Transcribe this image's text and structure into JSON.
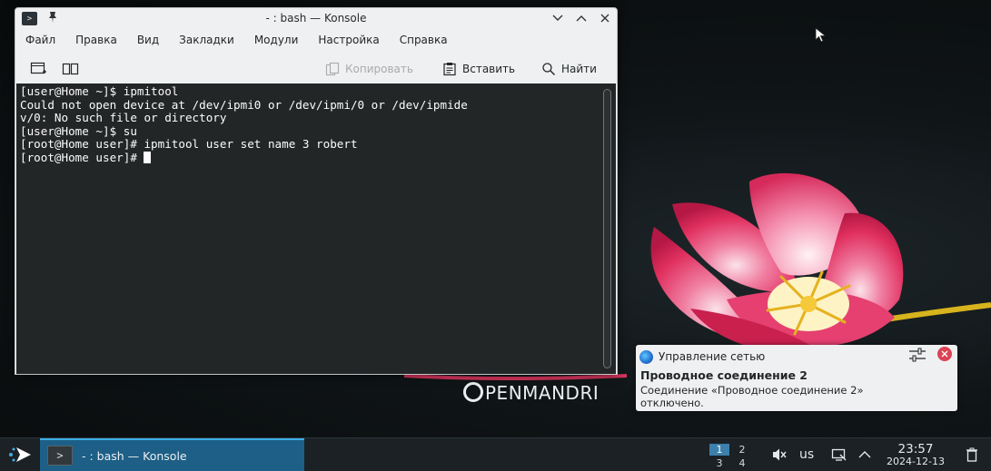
{
  "window": {
    "title": "- : bash — Konsole",
    "app_glyph": ">",
    "menu": [
      "Файл",
      "Правка",
      "Вид",
      "Закладки",
      "Модули",
      "Настройка",
      "Справка"
    ],
    "toolbar": {
      "copy_label": "Копировать",
      "paste_label": "Вставить",
      "find_label": "Найти"
    },
    "terminal_lines": [
      "[user@Home ~]$ ipmitool",
      "Could not open device at /dev/ipmi0 or /dev/ipmi/0 or /dev/ipmide",
      "v/0: No such file or directory",
      "[user@Home ~]$ su",
      "[root@Home user]# ipmitool user set name 3 robert",
      "[root@Home user]# "
    ]
  },
  "notification": {
    "app_name": "Управление сетью",
    "title": "Проводное соединение 2",
    "body": "Соединение «Проводное соединение 2» отключено."
  },
  "wallpaper": {
    "logo_text": "PENMANDRI"
  },
  "taskbar": {
    "task_label": "- : bash — Konsole",
    "task_glyph": ">",
    "pager": [
      "1",
      "2",
      "3",
      "4"
    ],
    "active_desktop": "1",
    "keyboard_layout": "us",
    "clock_time": "23:57",
    "clock_date": "2024-12-13"
  },
  "colors": {
    "accent": "#3daee9",
    "terminal_bg": "#232627",
    "close_red": "#da4453"
  }
}
